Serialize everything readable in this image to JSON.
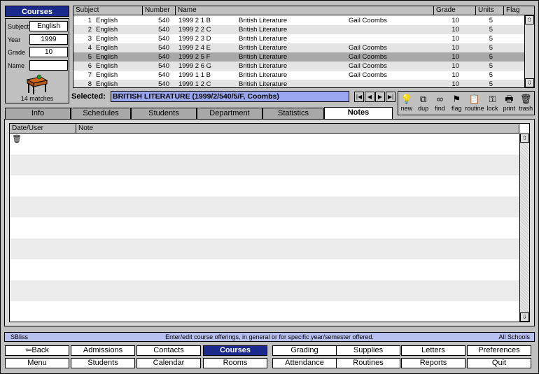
{
  "panel": {
    "title": "Courses",
    "subject_label": "Subject",
    "subject_value": "English",
    "year_label": "Year",
    "year_value": "1999",
    "grade_label": "Grade",
    "grade_value": "10",
    "name_label": "Name",
    "name_value": "",
    "matches": "14 matches"
  },
  "grid": {
    "headers": [
      "Subject",
      "Number",
      "Name",
      "Grade",
      "Units",
      "Flag"
    ],
    "rows": [
      {
        "n": "1",
        "subject": "English",
        "number": "540",
        "code": "1999  2  1  B",
        "title": "British Literature",
        "teacher": "Gail Coombs",
        "grade": "10",
        "units": "5"
      },
      {
        "n": "2",
        "subject": "English",
        "number": "540",
        "code": "1999  2  2  C",
        "title": "British Literature",
        "teacher": "",
        "grade": "10",
        "units": "5"
      },
      {
        "n": "3",
        "subject": "English",
        "number": "540",
        "code": "1999  2  3  D",
        "title": "British Literature",
        "teacher": "",
        "grade": "10",
        "units": "5"
      },
      {
        "n": "4",
        "subject": "English",
        "number": "540",
        "code": "1999  2  4  E",
        "title": "British Literature",
        "teacher": "Gail Coombs",
        "grade": "10",
        "units": "5"
      },
      {
        "n": "5",
        "subject": "English",
        "number": "540",
        "code": "1999  2  5  F",
        "title": "British Literature",
        "teacher": "Gail Coombs",
        "grade": "10",
        "units": "5"
      },
      {
        "n": "6",
        "subject": "English",
        "number": "540",
        "code": "1999  2  6  G",
        "title": "British Literature",
        "teacher": "Gail Coombs",
        "grade": "10",
        "units": "5"
      },
      {
        "n": "7",
        "subject": "English",
        "number": "540",
        "code": "1999  1  1  B",
        "title": "British Literature",
        "teacher": "Gail Coombs",
        "grade": "10",
        "units": "5"
      },
      {
        "n": "8",
        "subject": "English",
        "number": "540",
        "code": "1999  1  2  C",
        "title": "British Literature",
        "teacher": "",
        "grade": "10",
        "units": "5"
      }
    ]
  },
  "selected": {
    "label": "Selected:",
    "value": "BRITISH LITERATURE (1999/2/540/5/F, Coombs)"
  },
  "toolbar": {
    "items": [
      {
        "label": "new",
        "icon": "lightbulb-icon",
        "glyph": "💡"
      },
      {
        "label": "dup",
        "icon": "duplicate-icon",
        "glyph": "⧉"
      },
      {
        "label": "find",
        "icon": "glasses-icon",
        "glyph": "∞"
      },
      {
        "label": "flag",
        "icon": "flag-icon",
        "glyph": "⚑"
      },
      {
        "label": "routine",
        "icon": "clipboard-icon",
        "glyph": "📋"
      },
      {
        "label": "lock",
        "icon": "key-icon",
        "glyph": "⚿"
      },
      {
        "label": "print",
        "icon": "printer-icon",
        "glyph": "🖶"
      },
      {
        "label": "trash",
        "icon": "trash-icon",
        "glyph": "🗑"
      }
    ]
  },
  "tabs": [
    "Info",
    "Schedules",
    "Students",
    "Department",
    "Statistics",
    "Notes"
  ],
  "notes": {
    "headers": [
      "Date/User",
      "Note"
    ]
  },
  "status": {
    "left": "SBliss",
    "center": "Enter/edit course offerings, in general or for specific year/semester offered.",
    "right": "All Schools"
  },
  "nav": {
    "row1": [
      "Back",
      "Admissions",
      "Contacts",
      "Courses",
      "Grading",
      "Supplies",
      "Letters",
      "Preferences"
    ],
    "row2": [
      "Menu",
      "Students",
      "Calendar",
      "Rooms",
      "Attendance",
      "Routines",
      "Reports",
      "Quit"
    ]
  },
  "colors": {
    "title_bar": "#1a2a8a",
    "selected_field": "#9aa8f0",
    "status_bar": "#b8c0f0",
    "selected_row": "#a8a8a8"
  }
}
